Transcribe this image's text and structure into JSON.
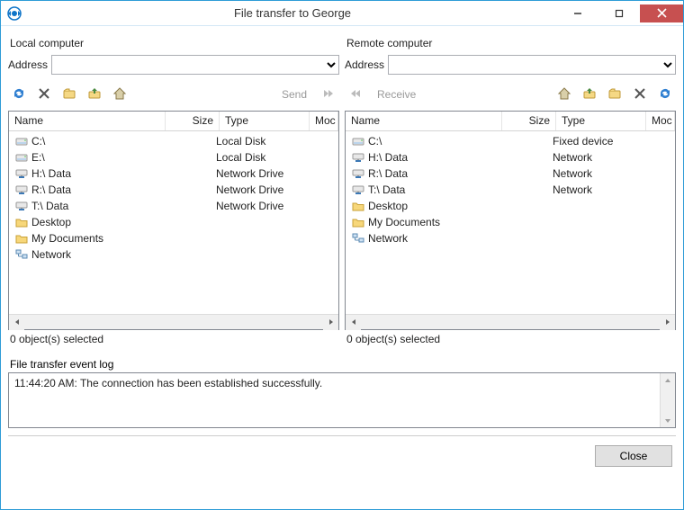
{
  "window": {
    "title": "File transfer to George"
  },
  "local": {
    "panel_label": "Local computer",
    "address_label": "Address",
    "address_value": "",
    "send_label": "Send",
    "columns": {
      "name": "Name",
      "size": "Size",
      "type": "Type",
      "mod": "Moc"
    },
    "items": [
      {
        "icon": "disk",
        "name": "C:\\",
        "size": "",
        "type": "Local Disk",
        "mod": ""
      },
      {
        "icon": "disk",
        "name": "E:\\",
        "size": "",
        "type": "Local Disk",
        "mod": ""
      },
      {
        "icon": "netdrive",
        "name": "H:\\ Data",
        "size": "",
        "type": "Network Drive",
        "mod": ""
      },
      {
        "icon": "netdrive",
        "name": "R:\\ Data",
        "size": "",
        "type": "Network Drive",
        "mod": ""
      },
      {
        "icon": "netdrive",
        "name": "T:\\ Data",
        "size": "",
        "type": "Network Drive",
        "mod": ""
      },
      {
        "icon": "folder-desktop",
        "name": "Desktop",
        "size": "",
        "type": "",
        "mod": ""
      },
      {
        "icon": "folder-docs",
        "name": "My Documents",
        "size": "",
        "type": "",
        "mod": ""
      },
      {
        "icon": "network",
        "name": "Network",
        "size": "",
        "type": "",
        "mod": ""
      }
    ],
    "status": "0 object(s) selected"
  },
  "remote": {
    "panel_label": "Remote computer",
    "address_label": "Address",
    "address_value": "",
    "receive_label": "Receive",
    "columns": {
      "name": "Name",
      "size": "Size",
      "type": "Type",
      "mod": "Moc"
    },
    "items": [
      {
        "icon": "disk",
        "name": "C:\\",
        "size": "",
        "type": "Fixed device",
        "mod": ""
      },
      {
        "icon": "netdrive",
        "name": "H:\\ Data",
        "size": "",
        "type": "Network",
        "mod": ""
      },
      {
        "icon": "netdrive",
        "name": "R:\\ Data",
        "size": "",
        "type": "Network",
        "mod": ""
      },
      {
        "icon": "netdrive",
        "name": "T:\\ Data",
        "size": "",
        "type": "Network",
        "mod": ""
      },
      {
        "icon": "folder-desktop",
        "name": "Desktop",
        "size": "",
        "type": "",
        "mod": ""
      },
      {
        "icon": "folder-docs",
        "name": "My Documents",
        "size": "",
        "type": "",
        "mod": ""
      },
      {
        "icon": "network",
        "name": "Network",
        "size": "",
        "type": "",
        "mod": ""
      }
    ],
    "status": "0 object(s) selected"
  },
  "log": {
    "label": "File transfer event log",
    "entries": [
      "11:44:20 AM: The connection has been established successfully."
    ]
  },
  "footer": {
    "close_label": "Close"
  }
}
